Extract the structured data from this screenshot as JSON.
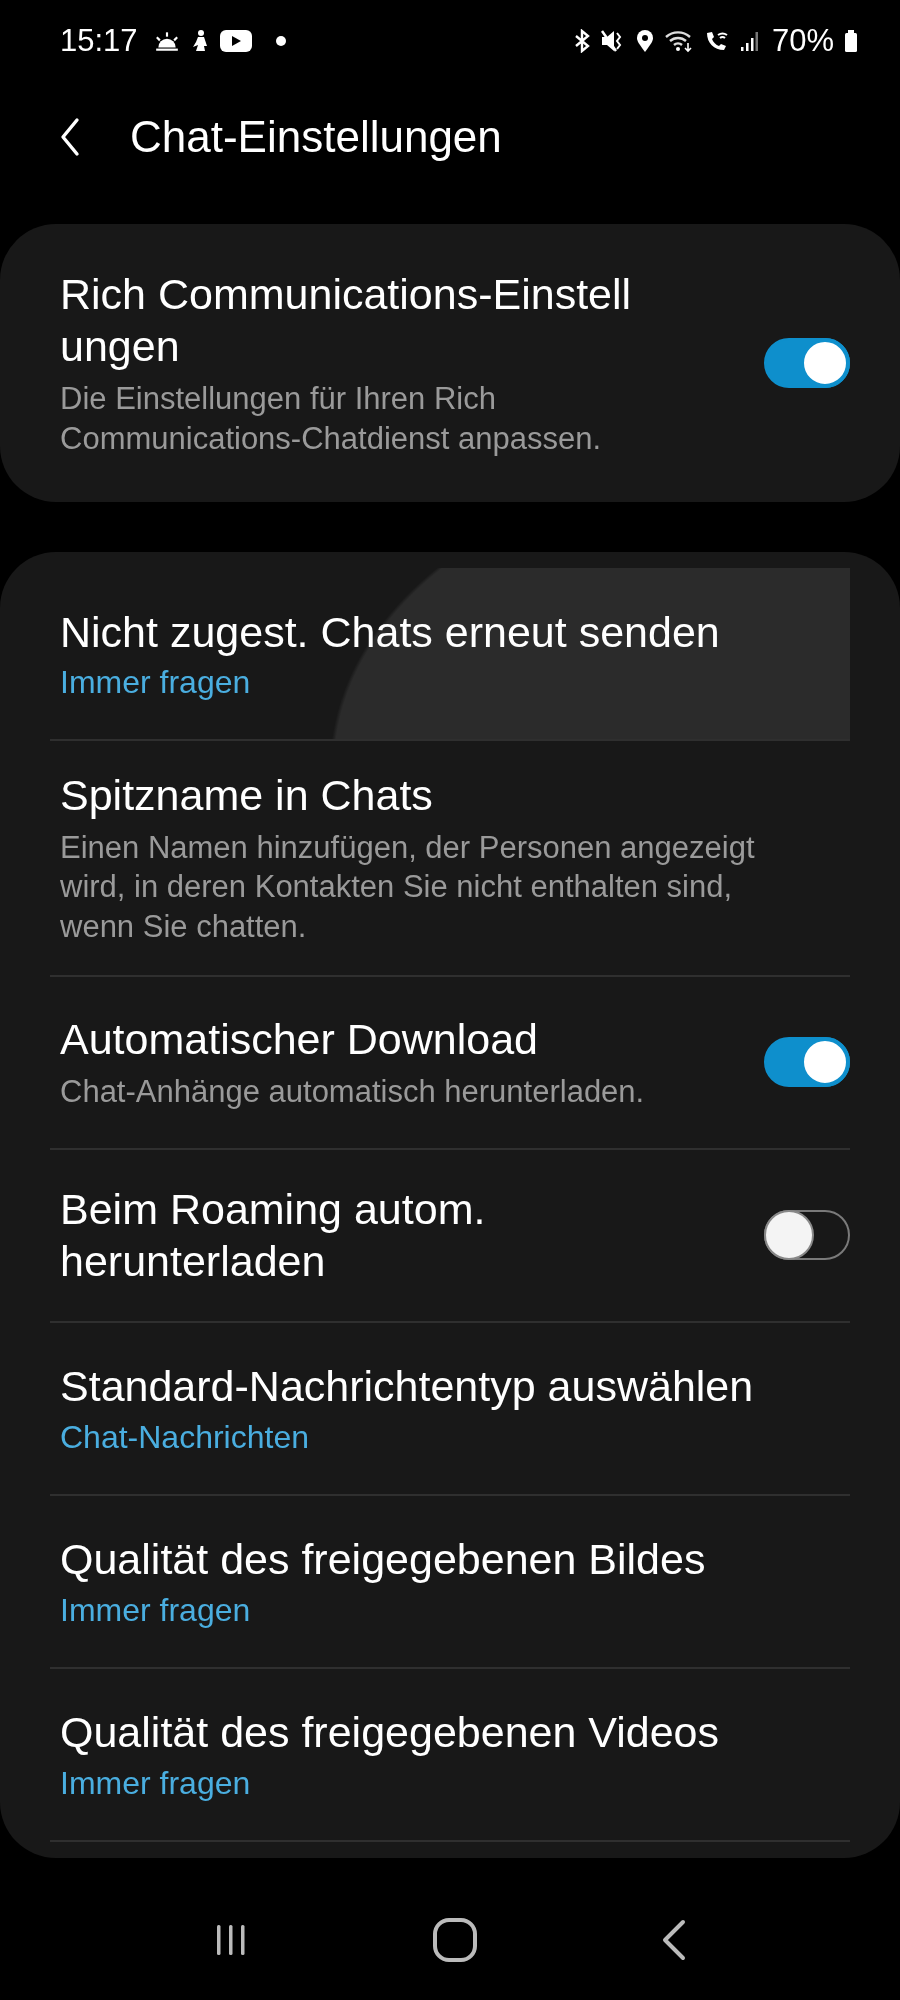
{
  "status_bar": {
    "time": "15:17",
    "battery": "70%"
  },
  "header": {
    "title": "Chat-Einstellungen"
  },
  "cards": [
    {
      "items": [
        {
          "kind": "toggle",
          "title_lines": [
            "Rich Communications-Einstell",
            "ungen"
          ],
          "description": "Die Einstellungen für Ihren Rich Communications-Chatdienst anpassen.",
          "on": true,
          "pressed": false
        }
      ]
    },
    {
      "items": [
        {
          "kind": "choice",
          "title_lines": [
            "Nicht zugest. Chats erneut senden"
          ],
          "value": "Immer fragen",
          "pressed": true
        },
        {
          "kind": "text",
          "title_lines": [
            "Spitzname in Chats"
          ],
          "description": "Einen Namen hinzufügen, der Personen angezeigt wird, in deren Kontakten Sie nicht enthalten sind, wenn Sie chatten.",
          "pressed": false
        },
        {
          "kind": "toggle",
          "title_lines": [
            "Automatischer Download"
          ],
          "description": "Chat-Anhänge automatisch herunterladen.",
          "on": true,
          "pressed": false
        },
        {
          "kind": "toggle",
          "title_lines": [
            "Beim Roaming autom.",
            "herunterladen"
          ],
          "on": false,
          "pressed": false
        },
        {
          "kind": "choice",
          "title_lines": [
            "Standard-Nachrichtentyp auswählen"
          ],
          "value": "Chat-Nachrichten",
          "pressed": false
        },
        {
          "kind": "choice",
          "title_lines": [
            "Qualität des freigegebenen Bildes"
          ],
          "value": "Immer fragen",
          "pressed": false
        },
        {
          "kind": "choice",
          "title_lines": [
            "Qualität des freigegebenen Videos"
          ],
          "value": "Immer fragen",
          "pressed": false
        }
      ]
    }
  ]
}
